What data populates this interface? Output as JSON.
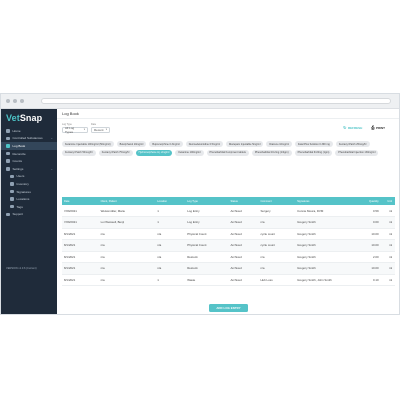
{
  "app": {
    "logo_first": "Vet",
    "logo_second": "Snap",
    "version": "VERSION v1.3.6 (Current)"
  },
  "colors": {
    "accent": "#55c3c8",
    "sidebar": "#1f2b3a",
    "sidebar_active": "#33465a"
  },
  "sidebar": {
    "items": [
      {
        "label": "Home",
        "icon": "home-icon"
      },
      {
        "label": "Controlled Substances",
        "icon": "pill-icon",
        "chevron": "⌄"
      },
      {
        "label": "Log Book",
        "icon": "book-icon",
        "active": true
      },
      {
        "label": "Reconcile",
        "icon": "scale-icon"
      },
      {
        "label": "Counts",
        "icon": "clipboard-icon"
      },
      {
        "label": "Settings",
        "icon": "gear-icon",
        "chevron": "⌄"
      },
      {
        "label": "Users",
        "icon": "user-icon",
        "sub": true
      },
      {
        "label": "Inventory",
        "icon": "box-icon",
        "sub": true
      },
      {
        "label": "Signatures",
        "icon": "pen-icon",
        "sub": true
      },
      {
        "label": "Locations",
        "icon": "pin-icon",
        "sub": true
      },
      {
        "label": "Tags",
        "icon": "tag-icon",
        "sub": true
      },
      {
        "label": "Support",
        "icon": "help-icon"
      }
    ]
  },
  "header": {
    "title": "Log Book"
  },
  "filters": {
    "log_type": {
      "label": "Log Type",
      "value": "All Log Types"
    },
    "date": {
      "label": "Date",
      "value": "Recent"
    }
  },
  "actions": {
    "refresh": "REFRESH",
    "print": "PRINT"
  },
  "chips": [
    {
      "label": "Ketamine Injectable 100mg/ml (50mg/ml)"
    },
    {
      "label": "Butorphanol 10mg/ml"
    },
    {
      "label": "Buprenorphine 0.3mg/ml"
    },
    {
      "label": "Dexmedetomidine 0.5mg/ml"
    },
    {
      "label": "Diazepam Injectable 5mg/ml"
    },
    {
      "label": "Diazene 10mg/ml"
    },
    {
      "label": "Fatal Plus Solution 0.390 mg"
    },
    {
      "label": "Fentanyl Patch 25mcg/hr"
    },
    {
      "label": "Fentanyl Patch 50mcg/hr"
    },
    {
      "label": "Fentanyl Patch 75mcg/hr"
    },
    {
      "label": "Hydromorphone inj. 2mg/ml",
      "active": true
    },
    {
      "label": "Ketamine 100mg/ml"
    },
    {
      "label": "Phenobarbital Kumpment tablets"
    },
    {
      "label": "Phenobarbital 16.2mg (1/4gm)"
    },
    {
      "label": "Phenobarbital 64.8mg (1gm)"
    },
    {
      "label": "Phenobarbital Injection 130mg/ml"
    }
  ],
  "table": {
    "columns": [
      "Date",
      "Client, Patient",
      "Location",
      "Log Type",
      "Status",
      "Comment",
      "Signatures",
      "Quantity",
      "Unit"
    ],
    "rows": [
      [
        "7/29/2021",
        "Weissmüller, Marie",
        "1",
        "Log Entry",
        "Archived",
        "Surgery",
        "Connie Moura, DVM",
        "0.59",
        "ml"
      ],
      [
        "7/29/2021",
        "Loi Weissell, Benji",
        "1",
        "Log Entry",
        "Archived",
        "n/a",
        "Gregory Smith",
        "0.60",
        "ml"
      ],
      [
        "8/1/2021",
        "n/a",
        "n/a",
        "Physical Count",
        "Archived",
        "cycle count",
        "Gregory Smith",
        "10.00",
        "ml"
      ],
      [
        "8/1/2021",
        "n/a",
        "n/a",
        "Physical Count",
        "Archived",
        "cycle count",
        "Gregory Smith",
        "10.00",
        "ml"
      ],
      [
        "8/1/2021",
        "n/a",
        "n/a",
        "Restock",
        "Archived",
        "n/a",
        "Gregory Smith",
        "2.00",
        "ml"
      ],
      [
        "8/1/2021",
        "n/a",
        "n/a",
        "Restock",
        "Archived",
        "n/a",
        "Gregory Smith",
        "10.00",
        "ml"
      ],
      [
        "8/1/2021",
        "n/a",
        "1",
        "Waste",
        "Archived",
        "Hub Loss",
        "Gregory Smith, John Smith",
        "0.10",
        "ml"
      ]
    ]
  },
  "add_button": "ADD LOG ENTRY"
}
